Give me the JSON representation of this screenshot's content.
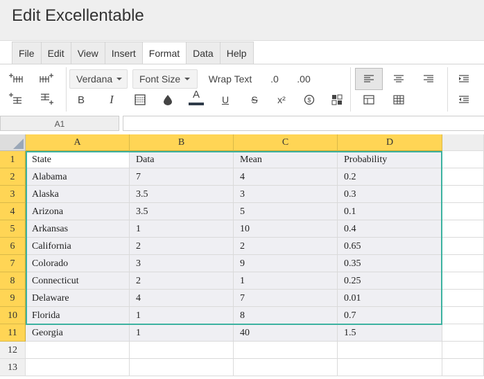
{
  "app": {
    "title": "Edit Excellentable"
  },
  "menu": [
    "File",
    "Edit",
    "View",
    "Insert",
    "Format",
    "Data",
    "Help"
  ],
  "active_menu": "Format",
  "toolbar": {
    "font_family": "Verdana",
    "font_size": "Font Size",
    "wrap_text": "Wrap Text",
    "decimal_decrease": ".0",
    "decimal_increase": ".00",
    "bold": "B",
    "italic": "I",
    "font_color": "A",
    "underline": "U",
    "strikethrough": "S",
    "superscript": "x²",
    "accent_color": "#2f3b49"
  },
  "name_box": "A1",
  "formula_value": "",
  "columns": [
    "A",
    "B",
    "C",
    "D"
  ],
  "row_numbers": [
    "1",
    "2",
    "3",
    "4",
    "5",
    "6",
    "7",
    "8",
    "9",
    "10",
    "11",
    "12",
    "13"
  ],
  "rows": [
    [
      "State",
      "Data",
      "Mean",
      "Probability"
    ],
    [
      "Alabama",
      "7",
      "4",
      "0.2"
    ],
    [
      "Alaska",
      "3.5",
      "3",
      "0.3"
    ],
    [
      "Arizona",
      "3.5",
      "5",
      "0.1"
    ],
    [
      "Arkansas",
      "1",
      "10",
      "0.4"
    ],
    [
      "California",
      "2",
      "2",
      "0.65"
    ],
    [
      "Colorado",
      "3",
      "9",
      "0.35"
    ],
    [
      "Connecticut",
      "2",
      "1",
      "0.25"
    ],
    [
      "Delaware",
      "4",
      "7",
      "0.01"
    ],
    [
      "Florida",
      "1",
      "8",
      "0.7"
    ],
    [
      "Georgia",
      "1",
      "40",
      "1.5"
    ],
    [
      "",
      "",
      "",
      ""
    ],
    [
      "",
      "",
      "",
      ""
    ]
  ],
  "colors": {
    "header_highlight": "#ffd555",
    "selection_border": "#3cb2a0"
  }
}
